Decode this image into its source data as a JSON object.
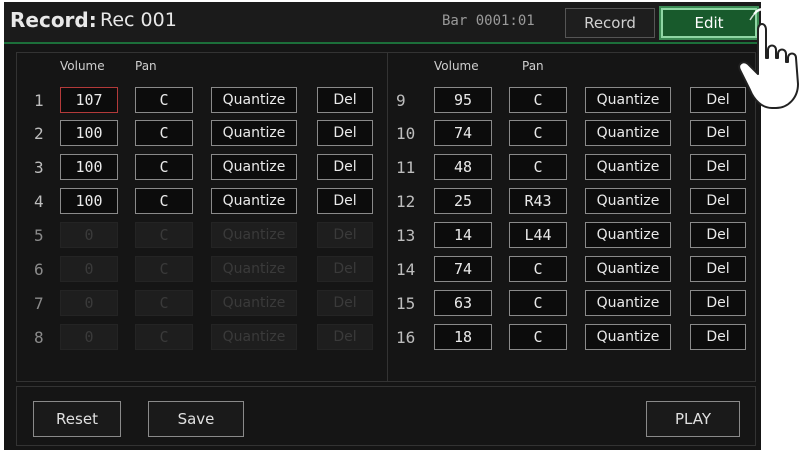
{
  "header": {
    "title_label": "Record:",
    "title_value": "Rec 001",
    "bar_position": "Bar 0001:01",
    "record_tab": "Record",
    "edit_tab": "Edit"
  },
  "columns": {
    "volume": "Volume",
    "pan": "Pan"
  },
  "tracks_left": [
    {
      "num": "1",
      "volume": "107",
      "pan": "C",
      "quantize": "Quantize",
      "del": "Del",
      "enabled": true
    },
    {
      "num": "2",
      "volume": "100",
      "pan": "C",
      "quantize": "Quantize",
      "del": "Del",
      "enabled": true
    },
    {
      "num": "3",
      "volume": "100",
      "pan": "C",
      "quantize": "Quantize",
      "del": "Del",
      "enabled": true
    },
    {
      "num": "4",
      "volume": "100",
      "pan": "C",
      "quantize": "Quantize",
      "del": "Del",
      "enabled": true
    },
    {
      "num": "5",
      "volume": "0",
      "pan": "C",
      "quantize": "Quantize",
      "del": "Del",
      "enabled": false
    },
    {
      "num": "6",
      "volume": "0",
      "pan": "C",
      "quantize": "Quantize",
      "del": "Del",
      "enabled": false
    },
    {
      "num": "7",
      "volume": "0",
      "pan": "C",
      "quantize": "Quantize",
      "del": "Del",
      "enabled": false
    },
    {
      "num": "8",
      "volume": "0",
      "pan": "C",
      "quantize": "Quantize",
      "del": "Del",
      "enabled": false
    }
  ],
  "tracks_right": [
    {
      "num": "9",
      "volume": "95",
      "pan": "C",
      "quantize": "Quantize",
      "del": "Del",
      "enabled": true
    },
    {
      "num": "10",
      "volume": "74",
      "pan": "C",
      "quantize": "Quantize",
      "del": "Del",
      "enabled": true
    },
    {
      "num": "11",
      "volume": "48",
      "pan": "C",
      "quantize": "Quantize",
      "del": "Del",
      "enabled": true
    },
    {
      "num": "12",
      "volume": "25",
      "pan": "R43",
      "quantize": "Quantize",
      "del": "Del",
      "enabled": true
    },
    {
      "num": "13",
      "volume": "14",
      "pan": "L44",
      "quantize": "Quantize",
      "del": "Del",
      "enabled": true
    },
    {
      "num": "14",
      "volume": "74",
      "pan": "C",
      "quantize": "Quantize",
      "del": "Del",
      "enabled": true
    },
    {
      "num": "15",
      "volume": "63",
      "pan": "C",
      "quantize": "Quantize",
      "del": "Del",
      "enabled": true
    },
    {
      "num": "16",
      "volume": "18",
      "pan": "C",
      "quantize": "Quantize",
      "del": "Del",
      "enabled": true
    }
  ],
  "footer": {
    "reset": "Reset",
    "save": "Save",
    "play": "PLAY"
  },
  "colors": {
    "accent_green": "#185a2c",
    "selected_border": "#b33a3a",
    "background": "#151515"
  },
  "icons": {
    "pointer": "hand-pointer-icon"
  }
}
